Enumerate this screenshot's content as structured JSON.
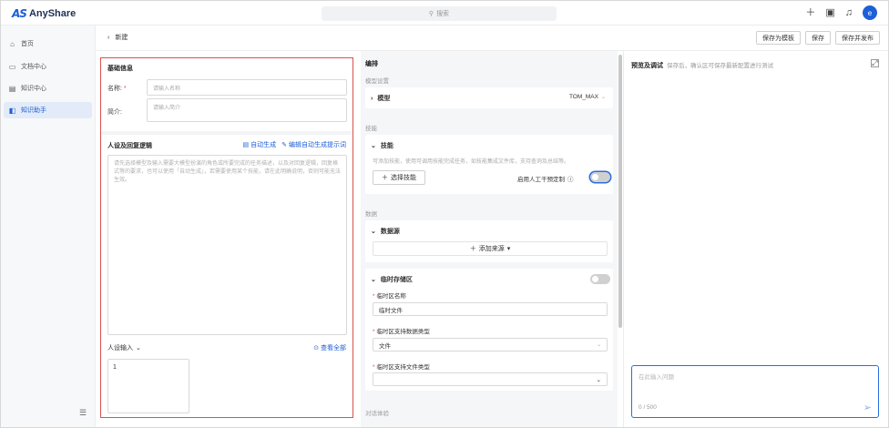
{
  "app": {
    "logo_mark": "AS",
    "logo_text": "AnyShare"
  },
  "topbar": {
    "search_placeholder": "搜索",
    "avatar_letter": "e"
  },
  "sidebar": {
    "items": [
      {
        "label": "首页",
        "icon": "home-icon"
      },
      {
        "label": "文档中心",
        "icon": "folder-icon"
      },
      {
        "label": "知识中心",
        "icon": "book-icon"
      },
      {
        "label": "知识助手",
        "icon": "assistant-icon",
        "active": true
      }
    ]
  },
  "header": {
    "title": "新建",
    "buttons": {
      "save_template": "保存为模板",
      "save": "保存",
      "save_publish": "保存并发布"
    }
  },
  "basic": {
    "title": "基础信息",
    "name_label": "名称:",
    "name_placeholder": "请输入名称",
    "desc_label": "简介:",
    "desc_placeholder": "请输入简介"
  },
  "persona": {
    "title": "人设及回复逻辑",
    "auto_gen": "自动生成",
    "edit_prompt": "编辑自动生成提示词",
    "placeholder": "请先选择模型及输入需要大模型扮演的角色或所要完成的任务描述，以及对回复逻辑，回复格式等的要求，也可以使用「自动生成」，若需要使用某个技能，请在此明确说明，否则可能无法生效。",
    "variable_label": "人设输入",
    "view_all": "查看全部",
    "line_no": "1"
  },
  "orchestration": {
    "title": "编排",
    "model_settings": "模型设置",
    "model_label": "模型",
    "model_value": "TOM_MAX",
    "skills_section": "技能",
    "skills_label": "技能",
    "skills_desc": "可添加技能，使用可调用技能完成任务，如技能集成文件库，支持查询及总结等。",
    "select_skill": "选择技能",
    "manual_intervene": "启用人工干预定制",
    "data_section": "数据",
    "kb_label": "数据源",
    "add_source": "添加来源",
    "temp_area_label": "临时存储区",
    "temp_name_label": "临时区名称",
    "temp_name_value": "临时文件",
    "temp_type_label": "临时区支持数据类型",
    "temp_type_value": "文件",
    "temp_file_label": "临时区支持文件类型",
    "footer_section": "对话体验"
  },
  "preview": {
    "title": "预览及调试",
    "note": "保存后，确认区可保存最新配置进行测试",
    "input_placeholder": "在此输入问题",
    "counter": "0 / 500"
  }
}
